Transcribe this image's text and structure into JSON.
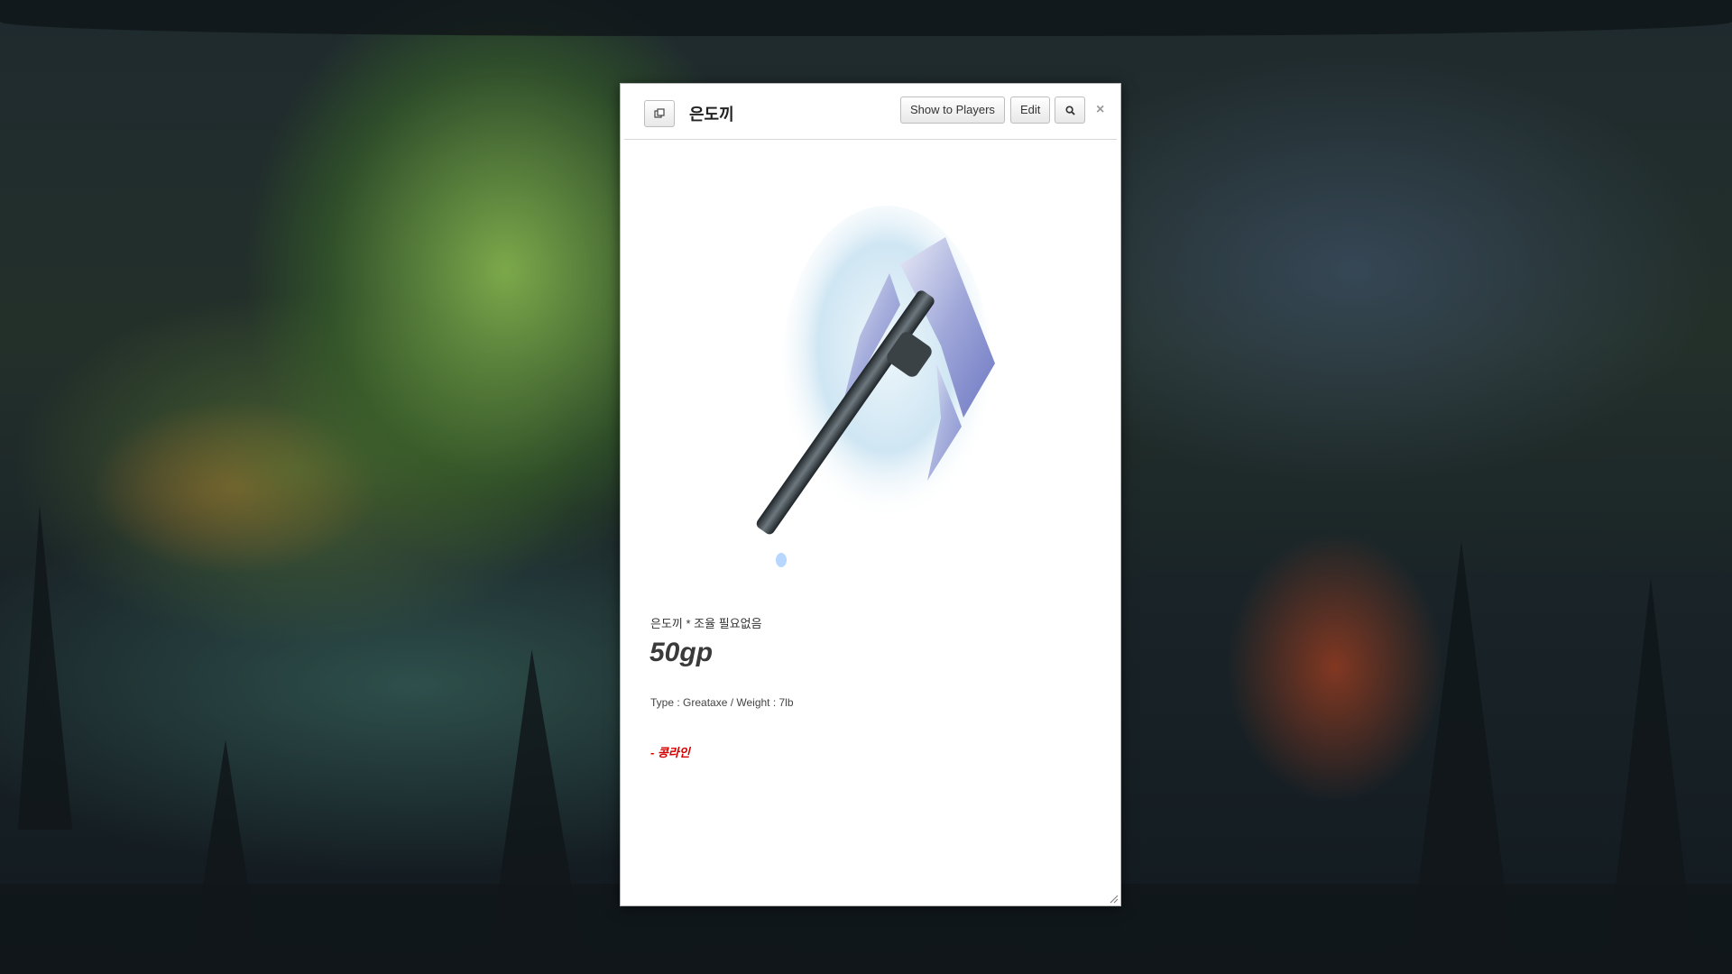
{
  "handout": {
    "title": "은도끼",
    "buttons": {
      "popout_icon": "popout-icon",
      "show_to_players": "Show to Players",
      "edit": "Edit",
      "search_icon": "search-icon",
      "close": "×"
    },
    "subtitle": "은도끼 * 조율 필요없음",
    "price": "50gp",
    "meta": "Type : Greataxe / Weight : 7lb",
    "author": "- 콩라인",
    "image_icon": "silver-greataxe-illustration"
  },
  "colors": {
    "dialog_bg": "#ffffff",
    "author_red": "#d40000",
    "price_gray": "#3a3a3a"
  }
}
